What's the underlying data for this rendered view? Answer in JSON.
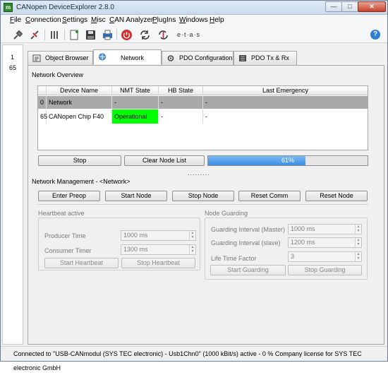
{
  "window": {
    "title": "CANopen DeviceExplorer 2.8.0",
    "app_icon_glyph": "m",
    "min_glyph": "—",
    "max_glyph": "□",
    "close_glyph": "✕"
  },
  "menu": {
    "items": [
      {
        "accel": "F",
        "rest": "ile"
      },
      {
        "accel": "C",
        "rest": "onnection"
      },
      {
        "accel": "S",
        "rest": "ettings"
      },
      {
        "accel": "M",
        "rest": "isc"
      },
      {
        "accel": "C",
        "rest": "AN Analyzer"
      },
      {
        "accel": "P",
        "rest": "lugIns"
      },
      {
        "accel": "W",
        "rest": "indows"
      },
      {
        "accel": "H",
        "rest": "elp"
      }
    ]
  },
  "toolbar": {
    "etas_logo": "e·t·a·s",
    "icons": [
      "connect-icon",
      "disconnect-icon",
      "settings-bars-icon",
      "new-file-icon",
      "save-icon",
      "print-icon",
      "power-icon",
      "refresh-icon",
      "reset-icon",
      "etas-logo-icon",
      "help-icon"
    ]
  },
  "node_list": {
    "items": [
      "1",
      "65"
    ]
  },
  "tabs": [
    {
      "label": "Object Browser",
      "icon": "object-browser-icon"
    },
    {
      "label": "Network",
      "icon": "network-icon"
    },
    {
      "label": "PDO Configuration",
      "icon": "pdo-config-icon"
    },
    {
      "label": "PDO Tx & Rx",
      "icon": "pdo-txrx-icon"
    }
  ],
  "overview": {
    "label": "Network Overview",
    "columns": [
      "Device Name",
      "NMT State",
      "HB State",
      "Last Emergency"
    ],
    "rows": [
      {
        "id": "0",
        "name": "Network",
        "nmt": "-",
        "hb": "-",
        "emcy": "-"
      },
      {
        "id": "65",
        "name": "CANopen Chip F40",
        "nmt": "Operational",
        "hb": "-",
        "emcy": "-"
      }
    ],
    "stop_label": "Stop",
    "clear_label": "Clear Node List",
    "progress_value": 61,
    "progress_text": "61%",
    "splitter": "........."
  },
  "management": {
    "label": "Network Management - <Network>",
    "buttons": [
      "Enter Preop",
      "Start Node",
      "Stop Node",
      "Reset Comm",
      "Reset Node"
    ]
  },
  "heartbeat": {
    "title": "Heartbeat active",
    "producer_label": "Producer Time",
    "producer_value": "1000 ms",
    "consumer_label": "Consumer Timer",
    "consumer_value": "1300 ms",
    "start_label": "Start Heartbeat",
    "stop_label": "Stop Heartbeat"
  },
  "guarding": {
    "title": "Node Guarding",
    "master_label": "Guarding Interval (Master)",
    "master_value": "1000 ms",
    "slave_label": "Guarding Interval (slave)",
    "slave_value": "1200 ms",
    "lifetime_label": "Life Time Factor",
    "lifetime_value": "3",
    "start_label": "Start Guarding",
    "stop_label": "Stop Guarding"
  },
  "status": {
    "text": "Connected to \"USB-CANmodul (SYS TEC electronic) - Usb1Chn0\" (1000 kBit/s)  active - 0 %  Company license for SYS TEC electronic GmbH"
  },
  "colors": {
    "operational": "#00ff00",
    "progress": "#3d8ce3",
    "network_row": "#a9a9a9"
  }
}
